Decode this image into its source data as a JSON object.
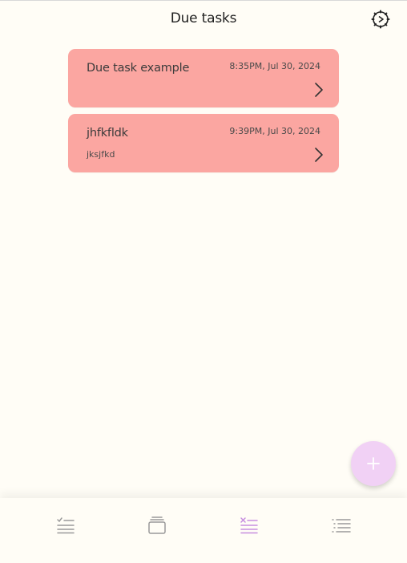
{
  "header": {
    "title": "Due tasks",
    "settings_icon": "gear-icon"
  },
  "tasks": [
    {
      "title": "Due task example",
      "time": "8:35PM, Jul 30, 2024",
      "description": ""
    },
    {
      "title": "jhfkfldk",
      "time": "9:39PM, Jul 30, 2024",
      "description": "jksjfkd"
    }
  ],
  "fab": {
    "icon": "plus-icon"
  },
  "nav": {
    "items": [
      {
        "icon": "checklist-icon",
        "active": false
      },
      {
        "icon": "stack-icon",
        "active": false
      },
      {
        "icon": "due-list-icon",
        "active": true
      },
      {
        "icon": "list-icon",
        "active": false
      }
    ]
  },
  "colors": {
    "background": "#fffdf6",
    "card": "#fba6a1",
    "fab": "#f1d1f5",
    "nav_active": "#c78ee0",
    "nav_inactive": "#9a9a9a"
  }
}
